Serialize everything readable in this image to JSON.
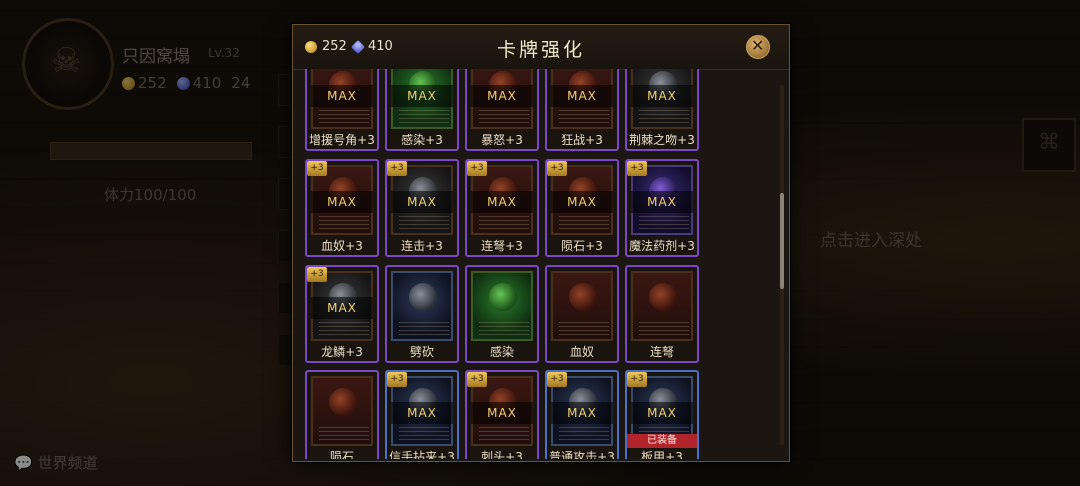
{
  "background": {
    "player_name": "只因窝塌",
    "player_level": "Lv.32",
    "gold": "252",
    "gems": "410",
    "extra": "24",
    "stamina": "体力100/100",
    "enter_hint": "点击进入深处",
    "chat_label": "世界频道"
  },
  "modal": {
    "title": "卡牌强化",
    "gold": "252",
    "gems": "410",
    "close_icon": "close-icon",
    "max_label": "MAX",
    "equipped_label": "已装备"
  },
  "cards": [
    {
      "name": "增援号角+3",
      "max": true,
      "plus": false,
      "theme": "red",
      "border": "purple"
    },
    {
      "name": "感染+3",
      "max": true,
      "plus": false,
      "theme": "green",
      "border": "purple"
    },
    {
      "name": "暴怒+3",
      "max": true,
      "plus": false,
      "theme": "red",
      "border": "purple"
    },
    {
      "name": "狂战+3",
      "max": true,
      "plus": false,
      "theme": "red",
      "border": "purple"
    },
    {
      "name": "荆棘之吻+3",
      "max": true,
      "plus": false,
      "theme": "gray",
      "border": "purple"
    },
    {
      "name": "血奴+3",
      "max": true,
      "plus": true,
      "theme": "red",
      "border": "purple"
    },
    {
      "name": "连击+3",
      "max": true,
      "plus": true,
      "theme": "gray",
      "border": "purple"
    },
    {
      "name": "连弩+3",
      "max": true,
      "plus": true,
      "theme": "red",
      "border": "purple"
    },
    {
      "name": "陨石+3",
      "max": true,
      "plus": true,
      "theme": "red",
      "border": "purple"
    },
    {
      "name": "魔法药剂+3",
      "max": true,
      "plus": true,
      "theme": "purple",
      "border": "purple"
    },
    {
      "name": "龙鳞+3",
      "max": true,
      "plus": true,
      "theme": "gray",
      "border": "purple"
    },
    {
      "name": "劈砍",
      "max": false,
      "plus": false,
      "theme": "blue",
      "border": "purple"
    },
    {
      "name": "感染",
      "max": false,
      "plus": false,
      "theme": "green",
      "border": "purple"
    },
    {
      "name": "血奴",
      "max": false,
      "plus": false,
      "theme": "red",
      "border": "purple"
    },
    {
      "name": "连弩",
      "max": false,
      "plus": false,
      "theme": "red",
      "border": "purple"
    },
    {
      "name": "陨石",
      "max": false,
      "plus": false,
      "theme": "red",
      "border": "purple"
    },
    {
      "name": "信手拈来+3",
      "max": true,
      "plus": true,
      "theme": "blue",
      "border": "blue"
    },
    {
      "name": "刺头+3",
      "max": true,
      "plus": true,
      "theme": "red",
      "border": "purple"
    },
    {
      "name": "普通攻击+3",
      "max": true,
      "plus": true,
      "theme": "blue",
      "border": "blue"
    },
    {
      "name": "板甲+3",
      "max": true,
      "plus": true,
      "theme": "blue",
      "border": "blue",
      "equipped": true
    }
  ],
  "plus_badge": "+3"
}
